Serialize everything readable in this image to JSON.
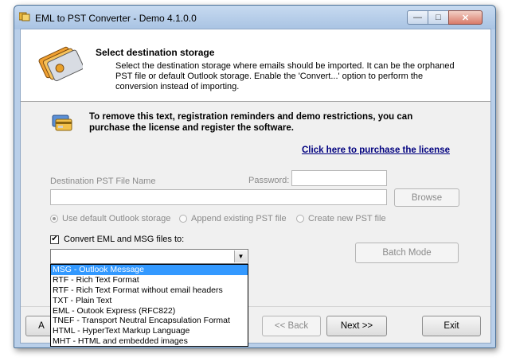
{
  "window": {
    "title": "EML to PST Converter - Demo 4.1.0.0",
    "min_glyph": "—",
    "max_glyph": "□",
    "close_glyph": "✕"
  },
  "header": {
    "title": "Select destination storage",
    "description": "Select the destination storage where emails should be imported. It can be the orphaned PST file or default Outlook storage. Enable the 'Convert...' option to perform the conversion instead of importing."
  },
  "registration": {
    "text": "To remove this text, registration reminders and demo restrictions, you can purchase the license and register the software.",
    "link": "Click here to purchase the license"
  },
  "destination": {
    "file_label": "Destination PST File Name",
    "file_value": "",
    "password_label": "Password:",
    "password_value": "",
    "browse_label": "Browse"
  },
  "storage_options": [
    {
      "label": "Use default Outlook storage",
      "selected": true
    },
    {
      "label": "Append existing PST file",
      "selected": false
    },
    {
      "label": "Create new PST file",
      "selected": false
    }
  ],
  "convert": {
    "checkbox_label": "Convert EML and MSG files to:",
    "checked": true,
    "check_glyph": "✔",
    "selected_value": "",
    "options": [
      "MSG - Outlook Message",
      "RTF - Rich Text Format",
      "RTF - Rich Text Format without email headers",
      "TXT - Plain Text",
      "EML - Outook Express (RFC822)",
      "TNEF - Transport Neutral Encapsulation Format",
      "HTML - HyperText Markup Language",
      "MHT - HTML and embedded images"
    ],
    "highlighted_index": 0
  },
  "buttons": {
    "batch_mode": "Batch Mode",
    "back": "<< Back",
    "next": "Next >>",
    "exit": "Exit",
    "partial_left": "A"
  },
  "colors": {
    "selection": "#3399ff",
    "link": "#00007f",
    "disabled_text": "#8a8a8a"
  }
}
